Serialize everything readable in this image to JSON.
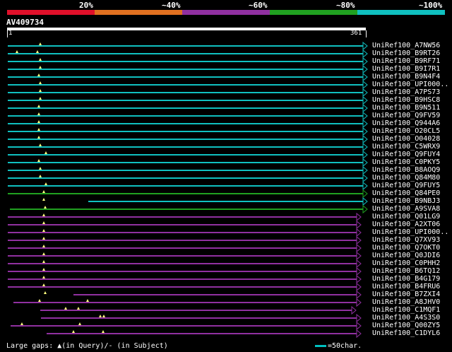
{
  "legend": {
    "labels": [
      "20%",
      "~40%",
      "~60%",
      "~80%",
      "~100%"
    ],
    "colors": [
      "#e0102a",
      "#e07020",
      "#9030a0",
      "#20a020",
      "#10c0c0"
    ]
  },
  "query": {
    "id": "AV409734",
    "start": "1",
    "end": "361"
  },
  "hits": [
    "UniRef100_A7NW56",
    "UniRef100_B9RT26",
    "UniRef100_B9RF71",
    "UniRef100_B9I7R1",
    "UniRef100_B9N4F4",
    "UniRef100_UPI000..",
    "UniRef100_A7PS73",
    "UniRef100_B9HSC8",
    "UniRef100_B9N511",
    "UniRef100_Q9FV59",
    "UniRef100_Q944A6",
    "UniRef100_O20CL5",
    "UniRef100_O04028",
    "UniRef100_C5WRX9",
    "UniRef100_Q9FUY4",
    "UniRef100_C0PKY5",
    "UniRef100_B8AOQ9",
    "UniRef100_Q84M80",
    "UniRef100_Q9FUY5",
    "UniRef100_Q84PE0",
    "UniRef100_B9NBJ3",
    "UniRef100_A9SVA8",
    "UniRef100_Q01LG9",
    "UniRef100_A2XT06",
    "UniRef100_UPI000..",
    "UniRef100_Q7XV93",
    "UniRef100_Q7OKT0",
    "UniRef100_Q0JDI6",
    "UniRef100_C0PHH2",
    "UniRef100_B6TQ12",
    "UniRef100_B4G179",
    "UniRef100_B4FRU6",
    "UniRef100_B7ZXI4",
    "UniRef100_A8JHV0",
    "UniRef100_C1MQF1",
    "UniRef100_A4S3S0",
    "UniRef100_Q00ZY5",
    "UniRef100_C1DYL6"
  ],
  "footer": {
    "gaps_text": "Large gaps: ▲(in Query)/- (in Subject)",
    "scale_text": "=50char."
  }
}
